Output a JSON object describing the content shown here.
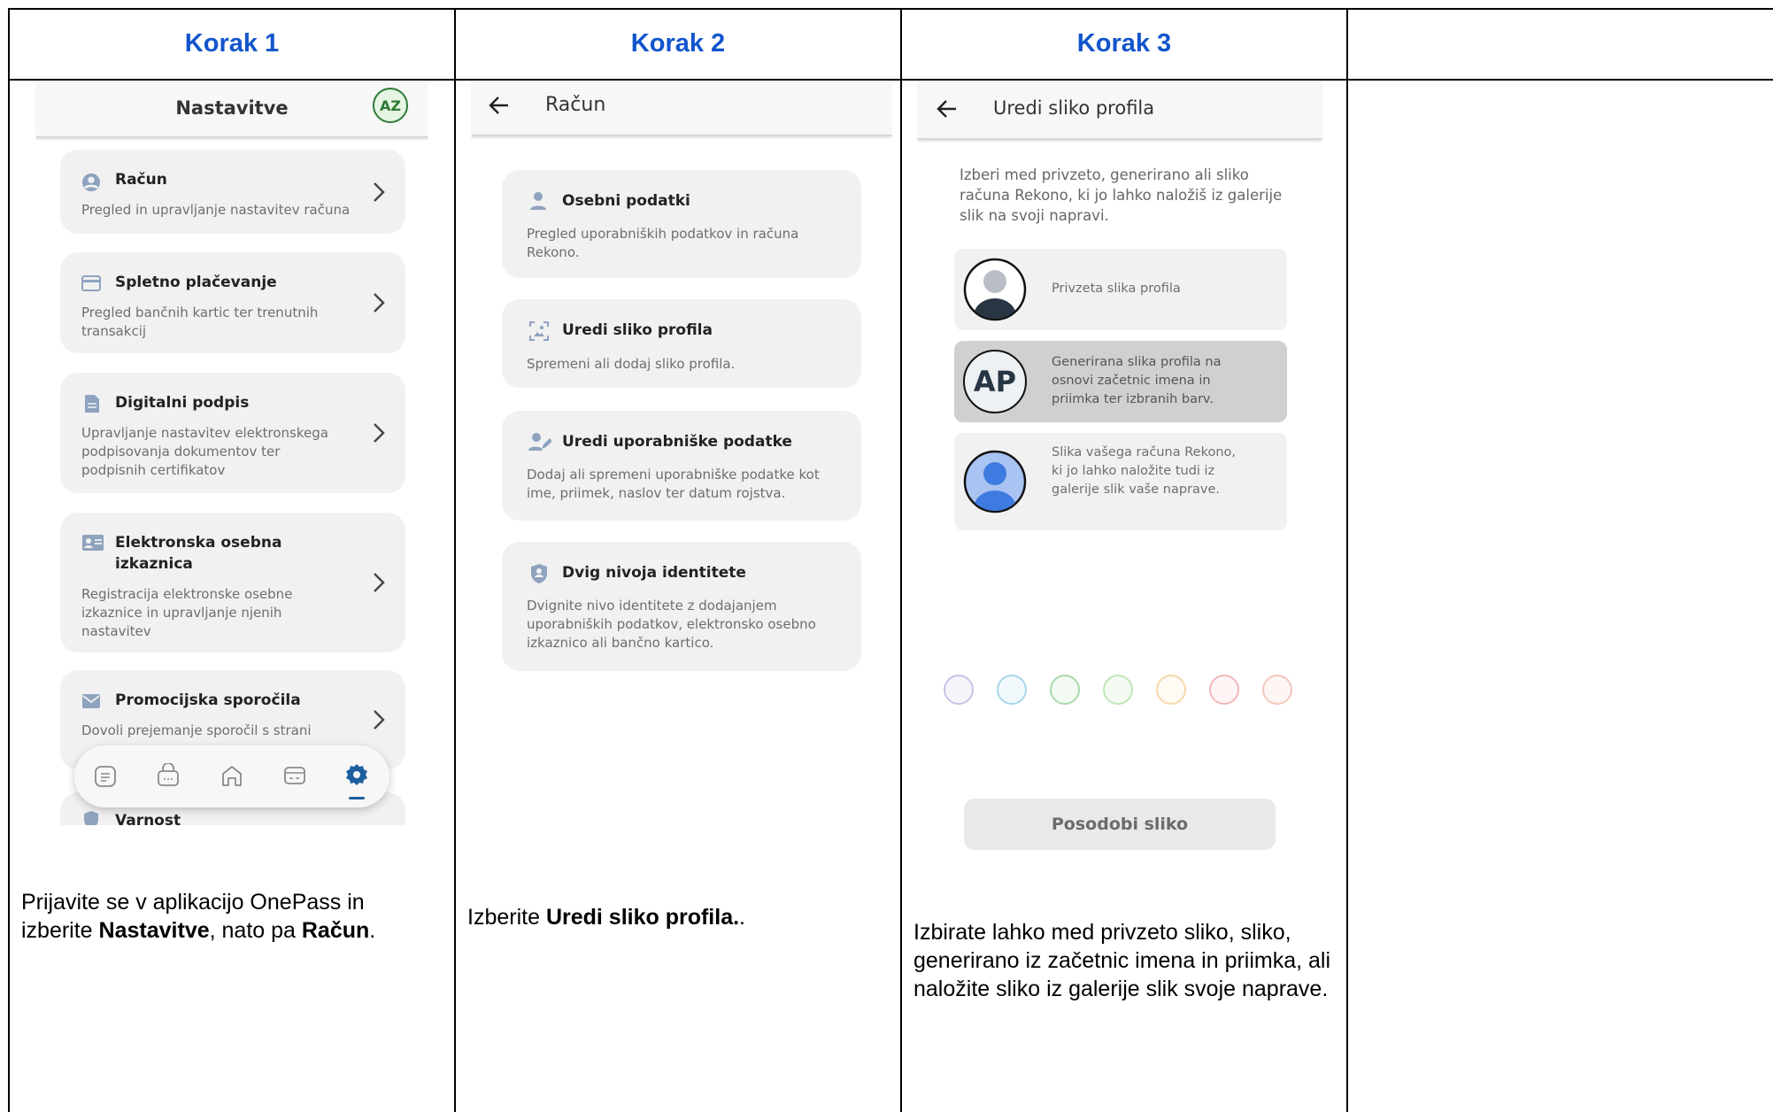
{
  "columns": [
    {
      "header": "Korak 1"
    },
    {
      "header": "Korak 2"
    },
    {
      "header": "Korak 3"
    },
    {
      "header": ""
    }
  ],
  "step1": {
    "title": "Nastavitve",
    "avatar": "AZ",
    "items": [
      {
        "title": "Račun",
        "desc": "Pregled in upravljanje nastavitev računa",
        "icon": "account-circle-icon"
      },
      {
        "title": "Spletno plačevanje",
        "desc": "Pregled bančnih kartic ter trenutnih transakcij",
        "icon": "credit-card-icon"
      },
      {
        "title": "Digitalni podpis",
        "desc": "Upravljanje nastavitev elektronskega podpisovanja dokumentov ter podpisnih certifikatov",
        "icon": "document-icon"
      },
      {
        "title": "Elektronska osebna izkaznica",
        "desc": "Registracija elektronske osebne izkaznice in upravljanje njenih nastavitev",
        "icon": "id-card-icon"
      },
      {
        "title": "Promocijska sporočila",
        "desc": "Dovoli prejemanje sporočil s strani",
        "icon": "mail-icon"
      },
      {
        "title": "Varnost",
        "desc": "",
        "icon": "shield-icon"
      }
    ],
    "nav": [
      "document-icon",
      "wallet-icon",
      "home-icon",
      "card-icon",
      "gear-icon"
    ],
    "caption": {
      "t1": "Prijavite se v aplikacijo OnePass in izberite ",
      "b1": "Nastavitve",
      "t2": ", nato pa ",
      "b2": "Račun",
      "t3": "."
    }
  },
  "step2": {
    "title": "Račun",
    "items": [
      {
        "title": "Osebni podatki",
        "desc": "Pregled uporabniških podatkov in računa Rekono.",
        "icon": "person-icon"
      },
      {
        "title": "Uredi sliko profila",
        "desc": "Spremeni ali dodaj sliko profila.",
        "icon": "image-frame-icon"
      },
      {
        "title": "Uredi uporabniške podatke",
        "desc": "Dodaj ali spremeni uporabniške podatke kot ime, priimek, naslov ter datum rojstva.",
        "icon": "person-edit-icon"
      },
      {
        "title": "Dvig nivoja identitete",
        "desc": "Dvignite nivo identitete z dodajanjem uporabniških podatkov, elektronsko osebno izkaznico ali bančno kartico.",
        "icon": "shield-person-icon"
      }
    ],
    "caption": {
      "t1": "Izberite ",
      "b1": "Uredi sliko profila.",
      "t2": "."
    }
  },
  "step3": {
    "title": "Uredi sliko profila",
    "intro": "Izberi med privzeto, generirano ali sliko računa Rekono, ki jo lahko naložiš iz galerije slik na svoji napravi.",
    "options": [
      {
        "text": "Privzeta slika profila",
        "avatar": ""
      },
      {
        "text": "Generirana slika profila na osnovi začetnic imena in priimka ter izbranih barv.",
        "avatar": "AP"
      },
      {
        "text": "Slika vašega računa Rekono, ki jo lahko naložite tudi iz galerije slik vaše naprave.",
        "avatar": ""
      }
    ],
    "swatches": [
      "#c9c2e6",
      "#a9d6ea",
      "#a9d8ac",
      "#bfe6b4",
      "#f5d9a8",
      "#f2b8b8",
      "#f2c6bd"
    ],
    "button": "Posodobi sliko",
    "caption": "Izbirate lahko med privzeto sliko, sliko, generirano iz začetnic imena in priimka, ali naložite sliko iz galerije slik svoje naprave."
  }
}
